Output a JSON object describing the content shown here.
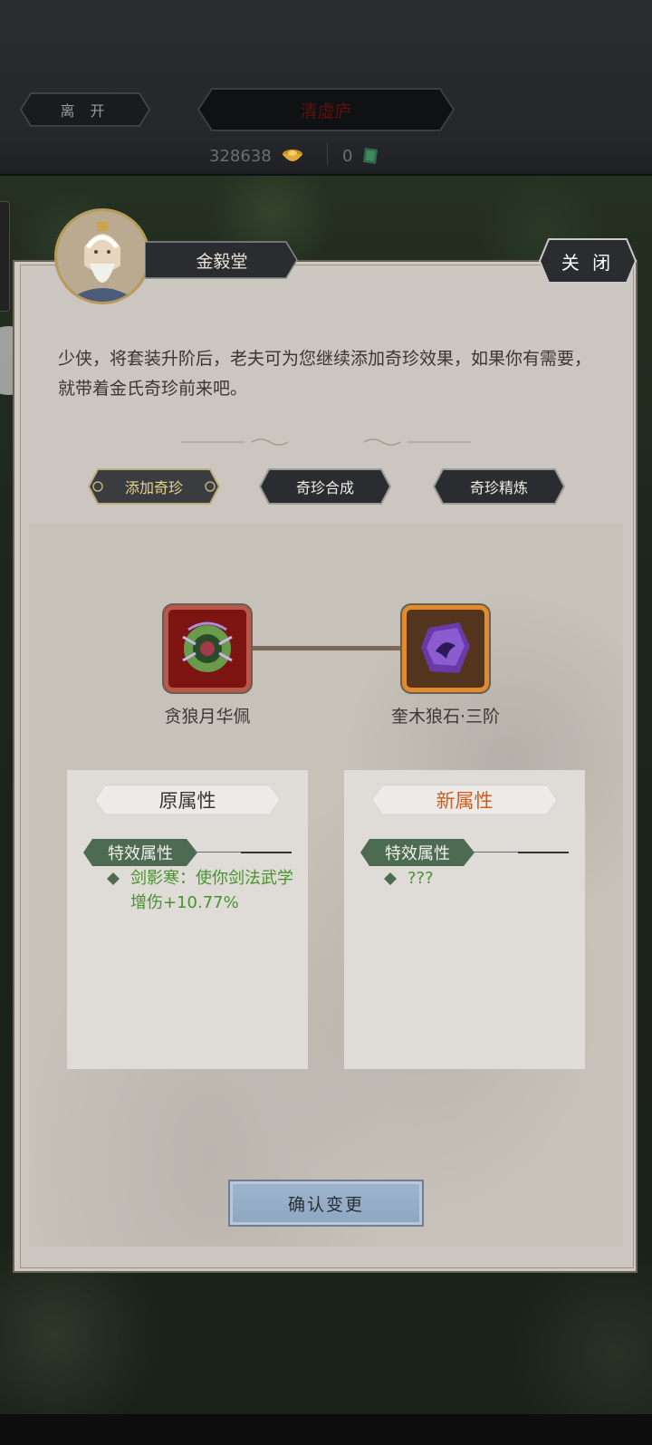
{
  "header": {
    "leave_label": "离 开",
    "location_label": "清虚庐",
    "silver_amount": "328638",
    "silver_icon": "gold-ingot-icon",
    "jade_amount": "0",
    "jade_icon": "jade-icon"
  },
  "npc": {
    "name": "金毅堂",
    "close_label": "关 闭",
    "dialog": "少侠，将套装升阶后，老夫可为您继续添加奇珍效果，如果你有需要，就带着金氏奇珍前来吧。"
  },
  "tabs": [
    {
      "label": "添加奇珍",
      "active": true
    },
    {
      "label": "奇珍合成",
      "active": false
    },
    {
      "label": "奇珍精炼",
      "active": false
    }
  ],
  "items": {
    "source": {
      "name": "贪狼月华佩",
      "icon": "jade-pendant-icon",
      "frame_color": "#b7584a"
    },
    "target": {
      "name": "奎木狼石·三阶",
      "icon": "purple-stone-icon",
      "frame_color": "#e08b2c"
    }
  },
  "attributes": {
    "original": {
      "title": "原属性",
      "tag": "特效属性",
      "effect": "剑影寒：使你剑法武学增伤+10.77%"
    },
    "new": {
      "title": "新属性",
      "tag": "特效属性",
      "effect": "???"
    }
  },
  "confirm_label": "确认变更",
  "colors": {
    "accent_green": "#46932d",
    "accent_orange": "#cf5d1f",
    "tag_green": "#4d6b52",
    "confirm_blue": "#9db4cc"
  }
}
